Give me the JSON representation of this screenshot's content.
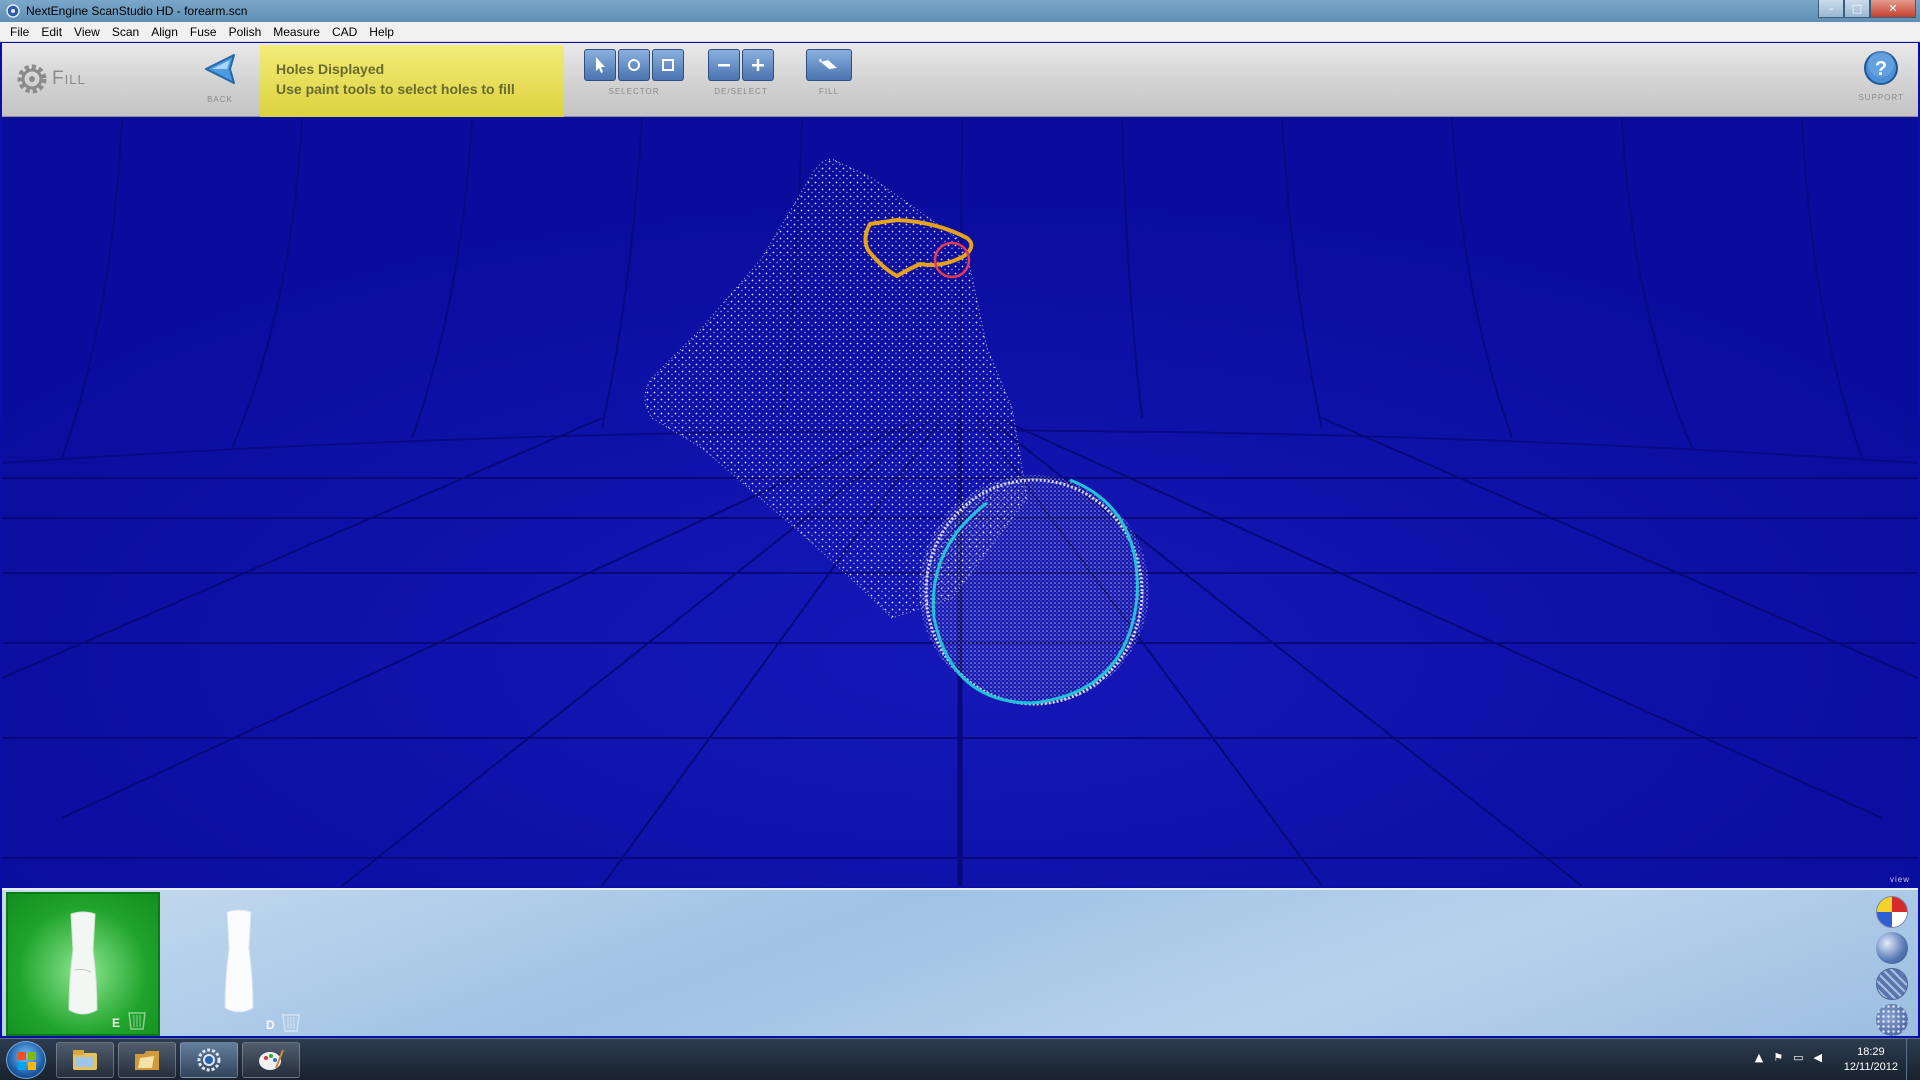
{
  "window": {
    "title": "NextEngine ScanStudio HD - forearm.scn",
    "controls": {
      "minimize": "–",
      "maximize": "□",
      "close": "✕"
    }
  },
  "menu": [
    "File",
    "Edit",
    "View",
    "Scan",
    "Align",
    "Fuse",
    "Polish",
    "Measure",
    "CAD",
    "Help"
  ],
  "toolbar": {
    "mode": "Fill",
    "back_label": "Back",
    "status_title": "Holes Displayed",
    "status_text": "Use paint tools to select holes to fill",
    "selector_label": "Selector",
    "deselect_label": "De/Select",
    "fill_label": "Fill",
    "support_label": "Support"
  },
  "viewport": {
    "background_color": "#0c0fa8",
    "view_label": "view",
    "hole_colors": {
      "selected_outline": "#e7a21a",
      "brush": "#e63a55",
      "rim": "#22c3d8"
    }
  },
  "tray": {
    "models": [
      {
        "badge": "E",
        "selected": true
      },
      {
        "badge": "D",
        "selected": false
      }
    ],
    "view_icons": [
      "color-sphere-icon",
      "solid-sphere-icon",
      "wireframe-sphere-icon",
      "points-sphere-icon"
    ]
  },
  "taskbar": {
    "apps": [
      "file-explorer-icon",
      "folder-icon",
      "scanstudio-icon",
      "paint-icon"
    ],
    "time": "18:29",
    "date": "12/11/2012",
    "tray_icons": [
      "show-hidden-icon",
      "action-center-icon",
      "network-icon",
      "volume-muted-icon"
    ]
  }
}
